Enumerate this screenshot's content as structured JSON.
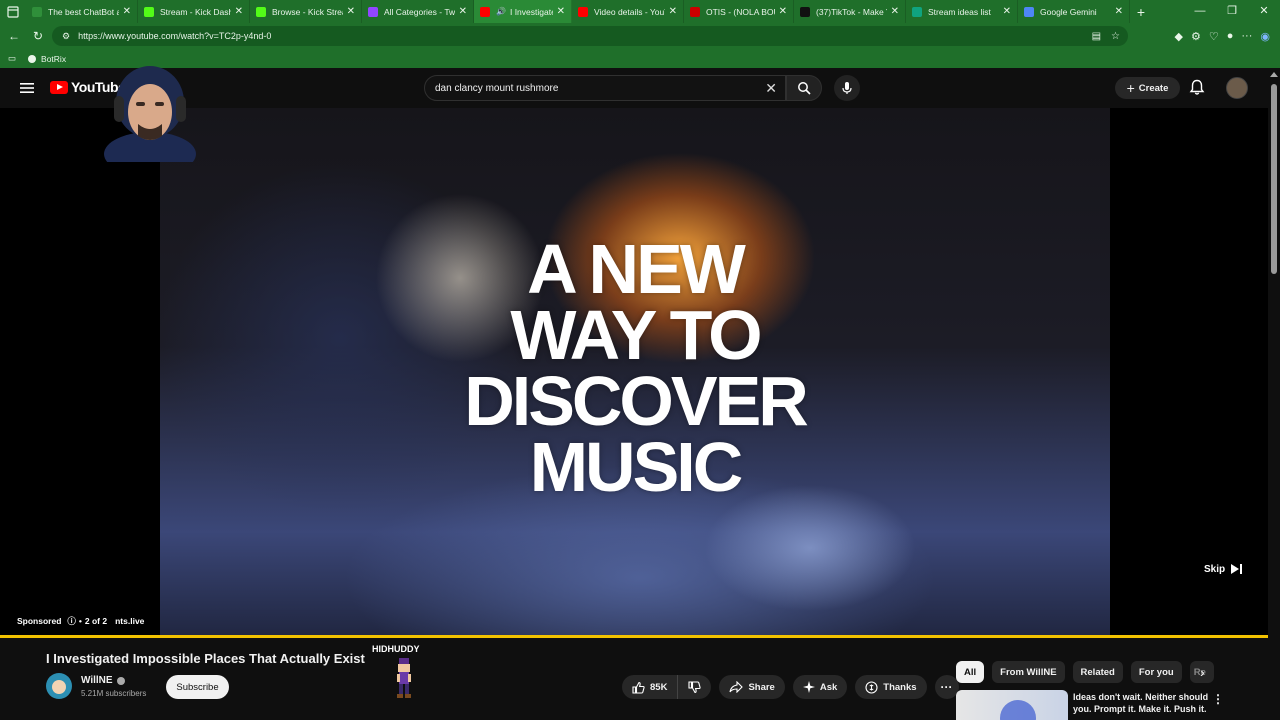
{
  "browser": {
    "tabs": [
      {
        "title": "The best ChatBot ar",
        "color": "#2f8f3a"
      },
      {
        "title": "Stream - Kick Dashb",
        "color": "#53fc18"
      },
      {
        "title": "Browse - Kick Strea",
        "color": "#53fc18"
      },
      {
        "title": "All Categories - Twi",
        "color": "#9146ff"
      },
      {
        "title": "I Investigated I",
        "color": "#ff0000",
        "active": true,
        "audio": true
      },
      {
        "title": "Video details - YouT",
        "color": "#ff0000"
      },
      {
        "title": "OTIS - (NOLA BOUN",
        "color": "#cc0000"
      },
      {
        "title": "(37)TikTok - Make Y",
        "color": "#111111"
      },
      {
        "title": "Stream ideas list",
        "color": "#10a37f"
      },
      {
        "title": "Google Gemini",
        "color": "#4e86f6"
      }
    ],
    "url": "https://www.youtube.com/watch?v=TC2p-y4nd-0",
    "bookmarks": [
      {
        "label": "BotRix"
      }
    ]
  },
  "youtube": {
    "logo_text": "YouTube",
    "search_query": "dan clancy mount rushmore",
    "create_label": "Create"
  },
  "player": {
    "headline": "A NEW\nWAY TO\nDISCOVER\nMUSIC",
    "skip_label": "Skip",
    "sponsored_label": "Sponsored",
    "ad_count": "2 of 2",
    "ad_domain": "nts.live",
    "progress_fraction": 1.0
  },
  "video": {
    "title": "I Investigated Impossible Places That Actually Exist",
    "overlay_name": "HIDHUDDY",
    "channel": "WillNE",
    "subscribers": "5.21M subscribers",
    "subscribe_label": "Subscribe",
    "likes": "85K",
    "share_label": "Share",
    "ask_label": "Ask",
    "thanks_label": "Thanks"
  },
  "sidebar": {
    "chips": [
      "All",
      "From WillNE",
      "Related",
      "For you",
      "Re"
    ],
    "selected_chip": "All",
    "ad_text": "Ideas don't wait. Neither should you. Prompt it. Make it. Push it."
  }
}
